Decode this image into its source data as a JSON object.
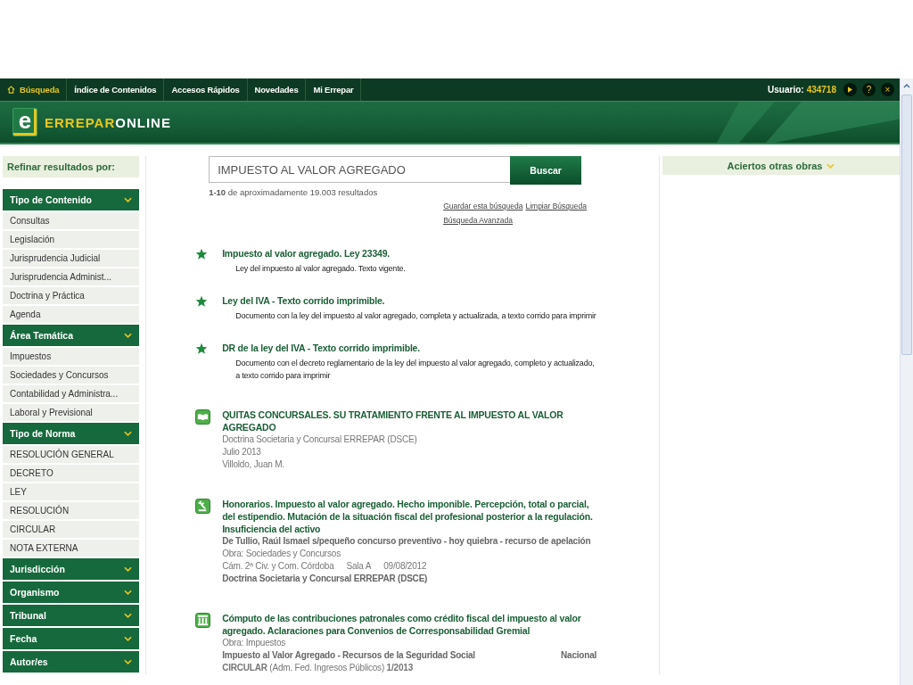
{
  "nav": {
    "items": [
      {
        "label": "Búsqueda",
        "selected": true
      },
      {
        "label": "Índice de Contenidos",
        "selected": false
      },
      {
        "label": "Accesos Rápidos",
        "selected": false
      },
      {
        "label": "Novedades",
        "selected": false
      },
      {
        "label": "Mi Errepar",
        "selected": false
      }
    ],
    "user_label": "Usuario:",
    "user_id": "434718",
    "help": "?",
    "close": "×"
  },
  "brand": {
    "mark": "e",
    "name": "ERREPAR",
    "suffix": "ONLINE"
  },
  "sidebar": {
    "title": "Refinar resultados por:",
    "sections": [
      {
        "title": "Tipo de Contenido",
        "items": [
          "Consultas",
          "Legislación",
          "Jurisprudencia Judicial",
          "Jurisprudencia Administ...",
          "Doctrina y Práctica",
          "Agenda"
        ]
      },
      {
        "title": "Área Temática",
        "items": [
          "Impuestos",
          "Sociedades y Concursos",
          "Contabilidad y Administra...",
          "Laboral y Previsional"
        ]
      },
      {
        "title": "Tipo de Norma",
        "items": [
          "RESOLUCIÓN GENERAL",
          "DECRETO",
          "LEY",
          "RESOLUCIÓN",
          "CIRCULAR",
          "NOTA EXTERNA"
        ]
      },
      {
        "title": "Jurisdicción"
      },
      {
        "title": "Organismo"
      },
      {
        "title": "Tribunal"
      },
      {
        "title": "Fecha"
      },
      {
        "title": "Autor/es"
      }
    ]
  },
  "search": {
    "value": "IMPUESTO AL VALOR AGREGADO",
    "button": "Buscar",
    "summary": "**1-10** de aproximadamente 19.003 resultados",
    "links": [
      "Guardar esta búsqueda",
      "Limpiar Búsqueda",
      "Búsqueda Avanzada"
    ]
  },
  "results": [
    {
      "kind": "star",
      "title": "Impuesto al valor agregado. Ley 23349.",
      "lines": [
        {
          "kind": "summary",
          "text": "Ley del impuesto al valor agregado. Texto vigente."
        }
      ]
    },
    {
      "kind": "star",
      "title": "Ley del IVA - Texto corrido imprimible.",
      "lines": [
        {
          "kind": "summary",
          "text": "Documento con la ley del impuesto al valor agregado, completa y actualizada, a texto corrido para imprimir"
        }
      ]
    },
    {
      "kind": "star",
      "title": "DR de la ley del IVA - Texto corrido imprimible.",
      "lines": [
        {
          "kind": "summary",
          "text": "Documento con el decreto reglamentario de la ley del impuesto al valor agregado, completo y actualizado, a texto corrido para imprimir"
        }
      ]
    },
    {
      "kind": "book",
      "title": "QUITAS CONCURSALES. SU TRATAMIENTO FRENTE AL IMPUESTO AL VALOR AGREGADO",
      "lines": [
        {
          "kind": "meta",
          "text": "Doctrina Societaria y Concursal ERREPAR (DSCE)"
        },
        {
          "kind": "meta",
          "text": "Julio 2013"
        },
        {
          "kind": "meta",
          "text": "Villoldo, Juan M."
        }
      ]
    },
    {
      "kind": "gavel",
      "title": "Honorarios. Impuesto al valor agregado. Hecho imponible. Percepción, total o parcial, del estipendio. Mutación de la situación fiscal del profesional posterior a la regulación. Insuficiencia del activo",
      "lines": [
        {
          "kind": "heading",
          "text": "De Tullio, Raúl Ismael s/pequeño concurso preventivo - hoy quiebra - recurso de apelación"
        },
        {
          "kind": "meta",
          "text": "Obra: Sociedades y Concursos"
        },
        {
          "kind": "meta",
          "parts": [
            "Cám. 2ª Civ. y Com. Córdoba",
            "Sala A",
            "09/08/2012"
          ]
        },
        {
          "kind": "heading",
          "text": "Doctrina Societaria y Concursal ERREPAR (DSCE)"
        }
      ]
    },
    {
      "kind": "columns",
      "title": "Cómputo de las contribuciones patronales como crédito fiscal del impuesto al valor agregado. Aclaraciones para Convenios de Corresponsabilidad Gremial",
      "lines": [
        {
          "kind": "meta",
          "text": "Obra: Impuestos"
        },
        {
          "kind": "heading",
          "parts": [
            "Impuesto al Valor Agregado - Recursos de la Seguridad Social",
            "Nacional"
          ]
        },
        {
          "kind": "meta",
          "text": "**CIRCULAR** (Adm. Fed. Ingresos Públicos) **1/2013**"
        }
      ]
    }
  ],
  "other_works": {
    "title": "Aciertos otras obras"
  }
}
